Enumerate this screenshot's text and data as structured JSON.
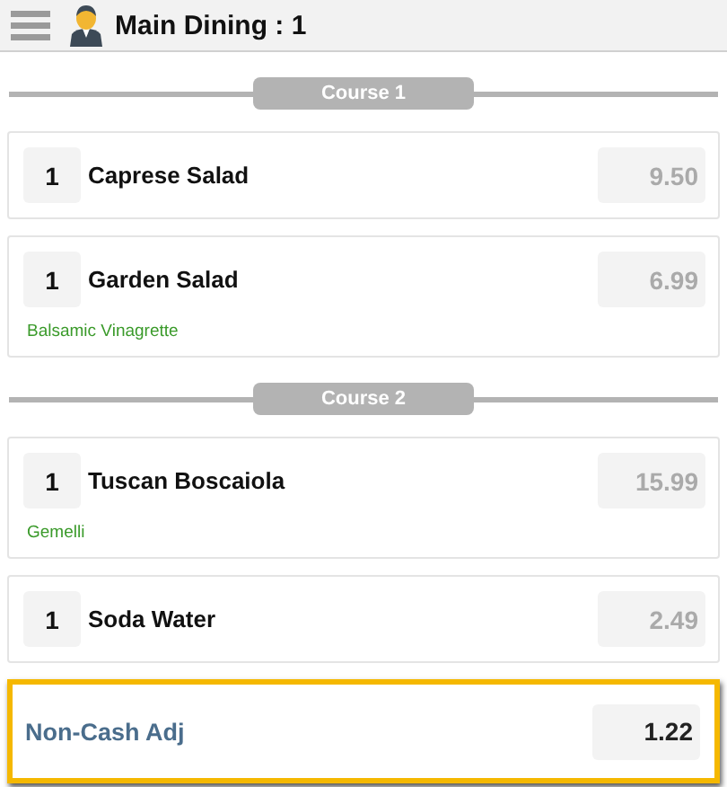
{
  "header": {
    "title": "Main Dining : 1"
  },
  "courses": [
    {
      "label": "Course 1",
      "items": [
        {
          "qty": "1",
          "name": "Caprese Salad",
          "price": "9.50"
        },
        {
          "qty": "1",
          "name": "Garden Salad",
          "price": "6.99",
          "modifier": "Balsamic Vinagrette"
        }
      ]
    },
    {
      "label": "Course 2",
      "items": [
        {
          "qty": "1",
          "name": "Tuscan Boscaiola",
          "price": "15.99",
          "modifier": "Gemelli"
        },
        {
          "qty": "1",
          "name": "Soda Water",
          "price": "2.49"
        }
      ]
    }
  ],
  "adjustment": {
    "label": "Non-Cash Adj",
    "amount": "1.22",
    "highlighted": true
  }
}
